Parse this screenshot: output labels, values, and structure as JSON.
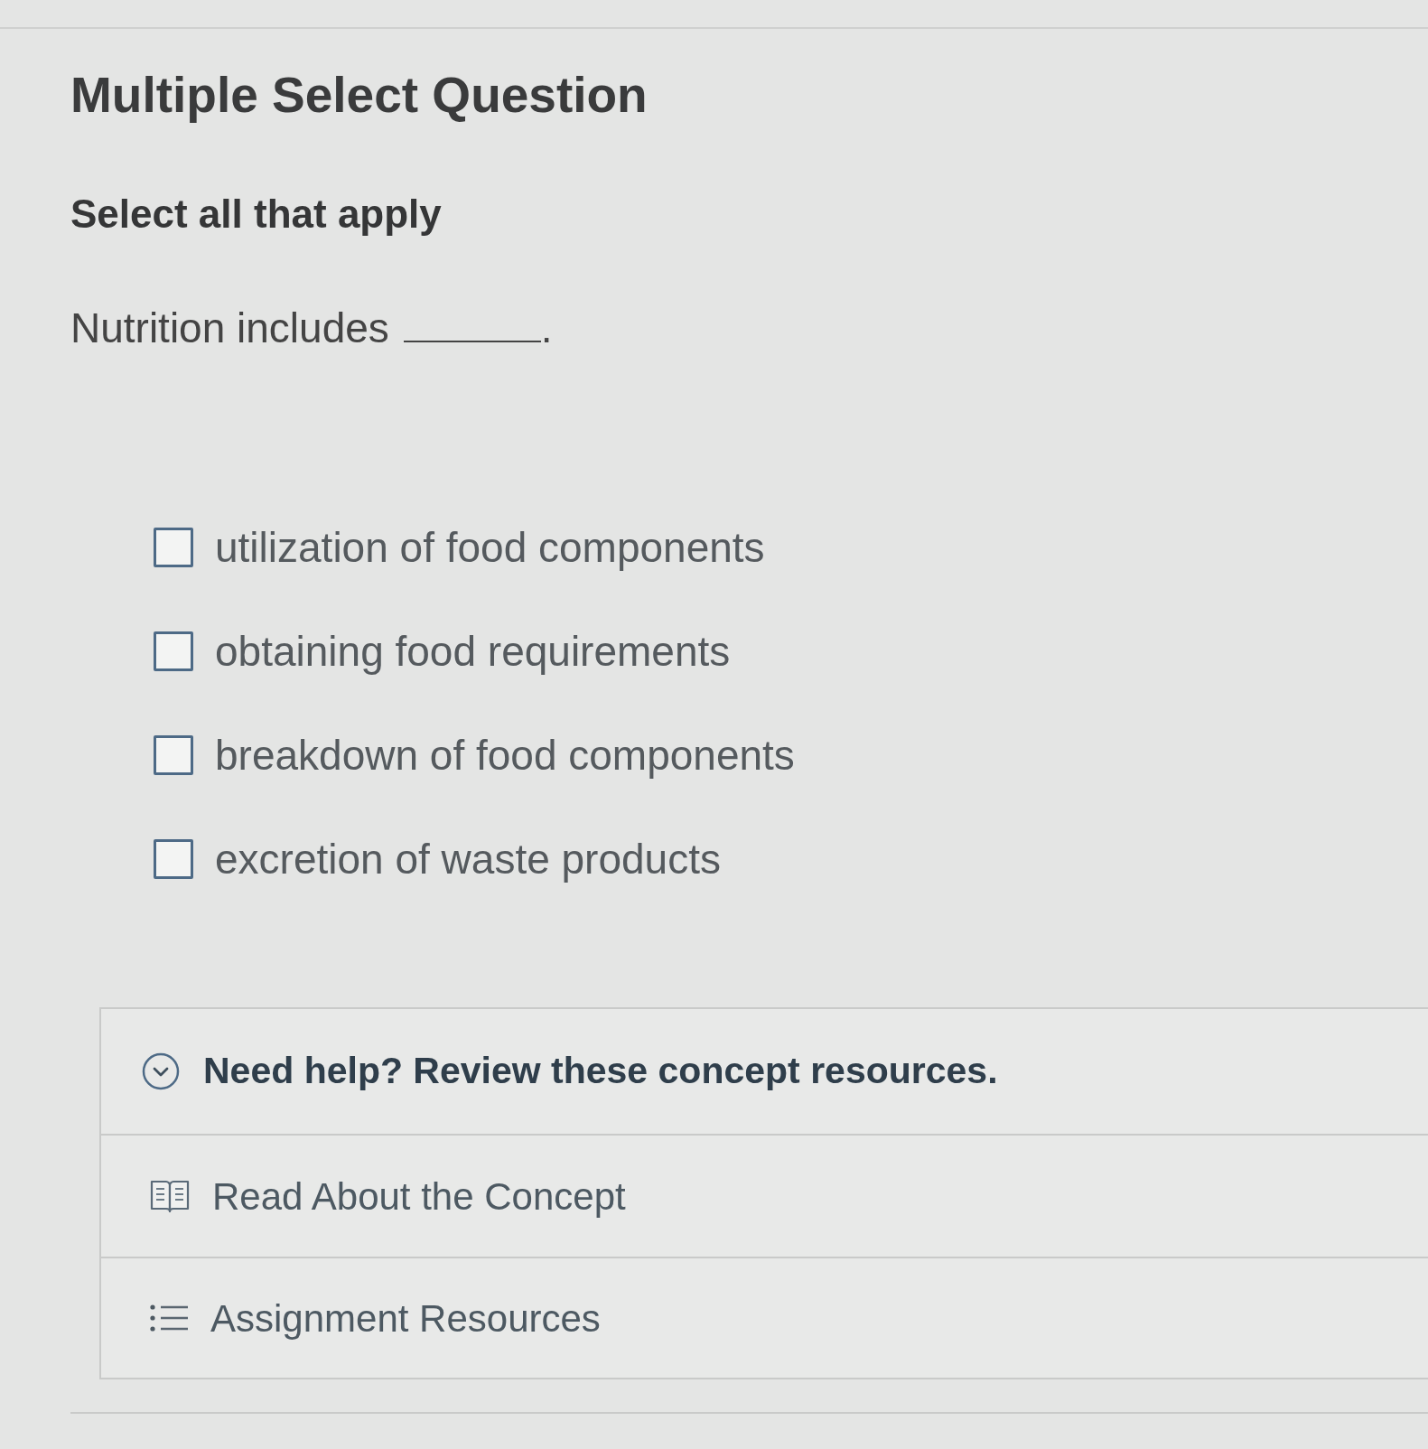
{
  "title": "Multiple Select Question",
  "instruction": "Select all that apply",
  "prompt": {
    "before": "Nutrition includes",
    "after": "."
  },
  "options": [
    {
      "label": "utilization of food components",
      "checked": false
    },
    {
      "label": "obtaining food requirements",
      "checked": false
    },
    {
      "label": "breakdown of food components",
      "checked": false
    },
    {
      "label": "excretion of waste products",
      "checked": false
    }
  ],
  "help": {
    "title": "Need help? Review these concept resources.",
    "expanded": true,
    "items": [
      {
        "kind": "book",
        "label": "Read About the Concept"
      },
      {
        "kind": "list",
        "label": "Assignment Resources"
      }
    ]
  }
}
